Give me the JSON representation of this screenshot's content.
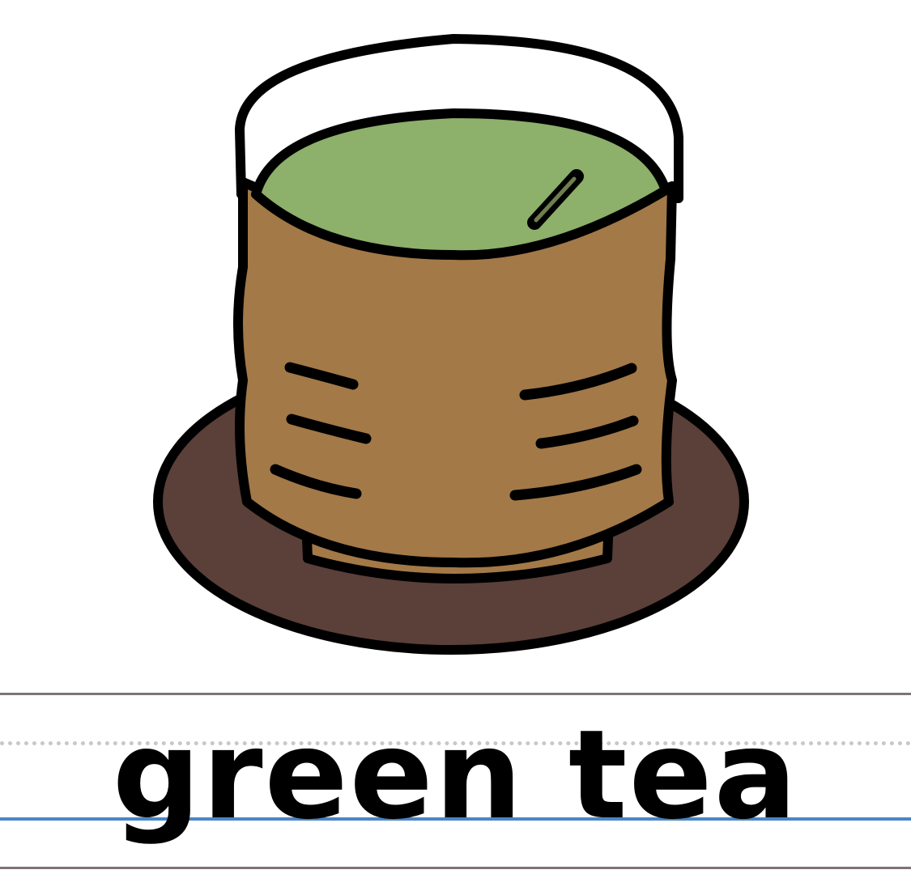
{
  "card": {
    "word": "green tea"
  },
  "illustration": {
    "icon": "green-tea-cup-on-saucer-icon",
    "colors": {
      "tea": "#8db06a",
      "cup": "#a37947",
      "saucer": "#5a4039",
      "outline": "#000000"
    }
  },
  "colors": {
    "guide_line": "#7f7375",
    "dotted_line": "#c8c8c8",
    "baseline": "#4a86c5"
  }
}
